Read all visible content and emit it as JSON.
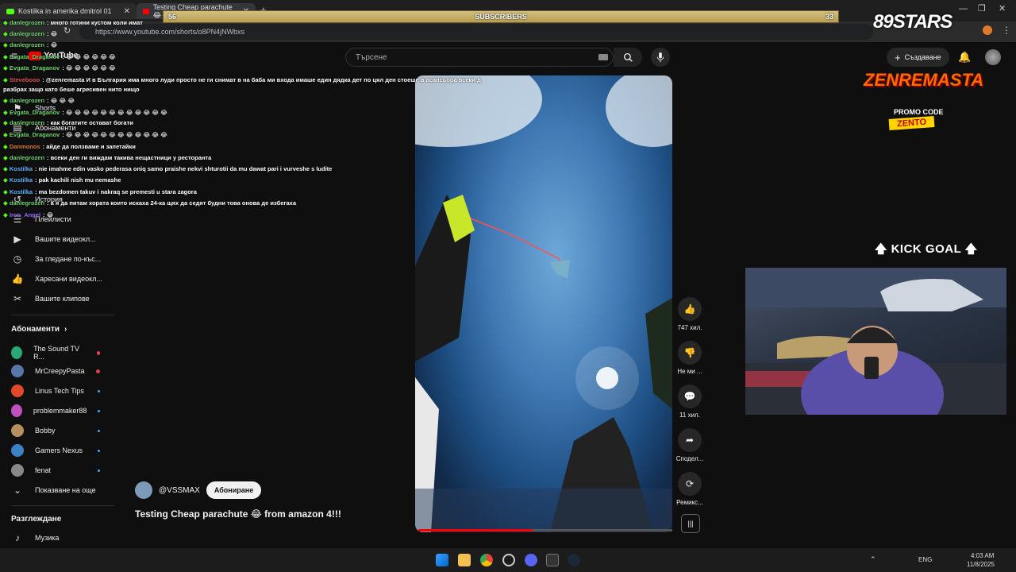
{
  "browser": {
    "tabs": [
      {
        "label": "Kostilka in amerika dmitrol 01"
      },
      {
        "label": "Testing Cheap parachute 😂 from..."
      }
    ],
    "url": "https://www.youtube.com/shorts/o8PN4jNWbxs"
  },
  "overlay": {
    "subscribers_label": "SUBSCRIBERS",
    "subscribers_current": "56",
    "subscribers_goal": "33",
    "kick_goal": "🡅 KICK GOAL 🡅",
    "sponsor_brand": "89STARS",
    "promo_title": "ZENREMASTA",
    "promo_subtitle": "PROMO CODE",
    "promo_code": "ZENTO"
  },
  "youtube": {
    "logo": "YouTube",
    "search_placeholder": "Търсене",
    "create_label": "Създаване",
    "sidebar": {
      "items": [
        {
          "icon": "play-square-icon",
          "label": "Вашите видеокл..."
        },
        {
          "icon": "clock-icon",
          "label": "За гледане по-къс..."
        },
        {
          "icon": "thumbs-up-icon",
          "label": "Харесани видеокл..."
        },
        {
          "icon": "scissors-icon",
          "label": "Вашите клипове"
        }
      ],
      "partial_items": [
        {
          "icon": "home-icon",
          "label": "Shorts"
        },
        {
          "icon": "subscriptions-icon",
          "label": "Абонаменти"
        },
        {
          "icon": "history-icon",
          "label": "История"
        },
        {
          "icon": "playlist-icon",
          "label": "Плейлисти"
        }
      ],
      "subs_header": "Абонаменти",
      "subs": [
        {
          "name": "The Sound TV R...",
          "color": "#2aa876",
          "live": true
        },
        {
          "name": "MrCreepyPasta",
          "color": "#5577aa",
          "live": true
        },
        {
          "name": "Linus Tech Tips",
          "color": "#e04a2a",
          "live": false
        },
        {
          "name": "problemmaker88",
          "color": "#c04fbf",
          "live": false
        },
        {
          "name": "Bobby",
          "color": "#b89060",
          "live": false
        },
        {
          "name": "Gamers Nexus",
          "color": "#3b82c4",
          "live": false
        },
        {
          "name": "fenat",
          "color": "#888888",
          "live": false
        }
      ],
      "show_more": "Показване на още",
      "explore_header": "Разглеждане",
      "music_label": "Музика"
    },
    "short": {
      "channel": "@VSSMAX",
      "subscribe": "Абониране",
      "title": "Testing Cheap parachute 😂 from amazon 4!!!",
      "progress": 0.45,
      "actions": [
        {
          "icon": "thumbs-up-icon",
          "label": "747 хил."
        },
        {
          "icon": "thumbs-down-icon",
          "label": "Не ми ..."
        },
        {
          "icon": "comment-icon",
          "label": "11 хил."
        },
        {
          "icon": "share-icon",
          "label": "Сподел..."
        },
        {
          "icon": "remix-icon",
          "label": "Ремикс..."
        }
      ]
    }
  },
  "chat": [
    {
      "user": "danlegrozen",
      "color": "#6fd36f",
      "msg": "много готини кустом коли имат"
    },
    {
      "user": "danlegrozen",
      "color": "#6fd36f",
      "msg": "😂"
    },
    {
      "user": "danlegrozen",
      "color": "#6fd36f",
      "msg": "😂"
    },
    {
      "user": "Evgata_Draganov",
      "color": "#6fd36f",
      "msg": "😂 😂 😂 😂 😂 😂"
    },
    {
      "user": "Evgata_Draganov",
      "color": "#6fd36f",
      "msg": "😂 😂 😂 😂 😂 😂"
    },
    {
      "user": "Stevebooo",
      "color": "#e05555",
      "msg": "@zenremasta И в България има много луди просто не ги снимат в на баба ми входа имаше един дядка дет по цял ден стоеше в асансьора всеки д"
    },
    {
      "user": "",
      "color": "#ffffff",
      "msg": "разбрах защо като беше агресивен нито нищо"
    },
    {
      "user": "danlegrozen",
      "color": "#6fd36f",
      "msg": "😂 😂 😂"
    },
    {
      "user": "Evgata_Draganov",
      "color": "#6fd36f",
      "msg": "😂 😂 😂 😂 😂 😂 😂 😂 😂 😂 😂 😂"
    },
    {
      "user": "danlegrozen",
      "color": "#6fd36f",
      "msg": "как богатите остават богати"
    },
    {
      "user": "Evgata_Draganov",
      "color": "#6fd36f",
      "msg": "😂 😂 😂 😂 😂 😂 😂 😂 😂 😂 😂 😂"
    },
    {
      "user": "Danmonos",
      "color": "#e07a2a",
      "msg": "айде да ползваме и запетайки"
    },
    {
      "user": "danlegrozen",
      "color": "#6fd36f",
      "msg": "всеки ден ги виждам такива нещастници у ресторанта"
    },
    {
      "user": "Kostilka",
      "color": "#5ab4ff",
      "msg": "nie imahme edin vasko pederasa oniq samo praishe nekvi shturotii da mu dawat pari i vurveshe s ludite"
    },
    {
      "user": "Kostilka",
      "color": "#5ab4ff",
      "msg": "pak kachili nish mu nemashe"
    },
    {
      "user": "Kostilka",
      "color": "#5ab4ff",
      "msg": "ma bezdomen takuv i nakraq se premesti u stara zagora"
    },
    {
      "user": "danlegrozen",
      "color": "#6fd36f",
      "msg": "а я да питам хората които искаха 24-ка щях да седят будни това онова де избегаха"
    },
    {
      "user": "Iron_Angel",
      "color": "#9b6bff",
      "msg": "😂"
    }
  ],
  "taskbar": {
    "lang": "ENG",
    "time": "4:03 AM",
    "date": "11/8/2025"
  }
}
